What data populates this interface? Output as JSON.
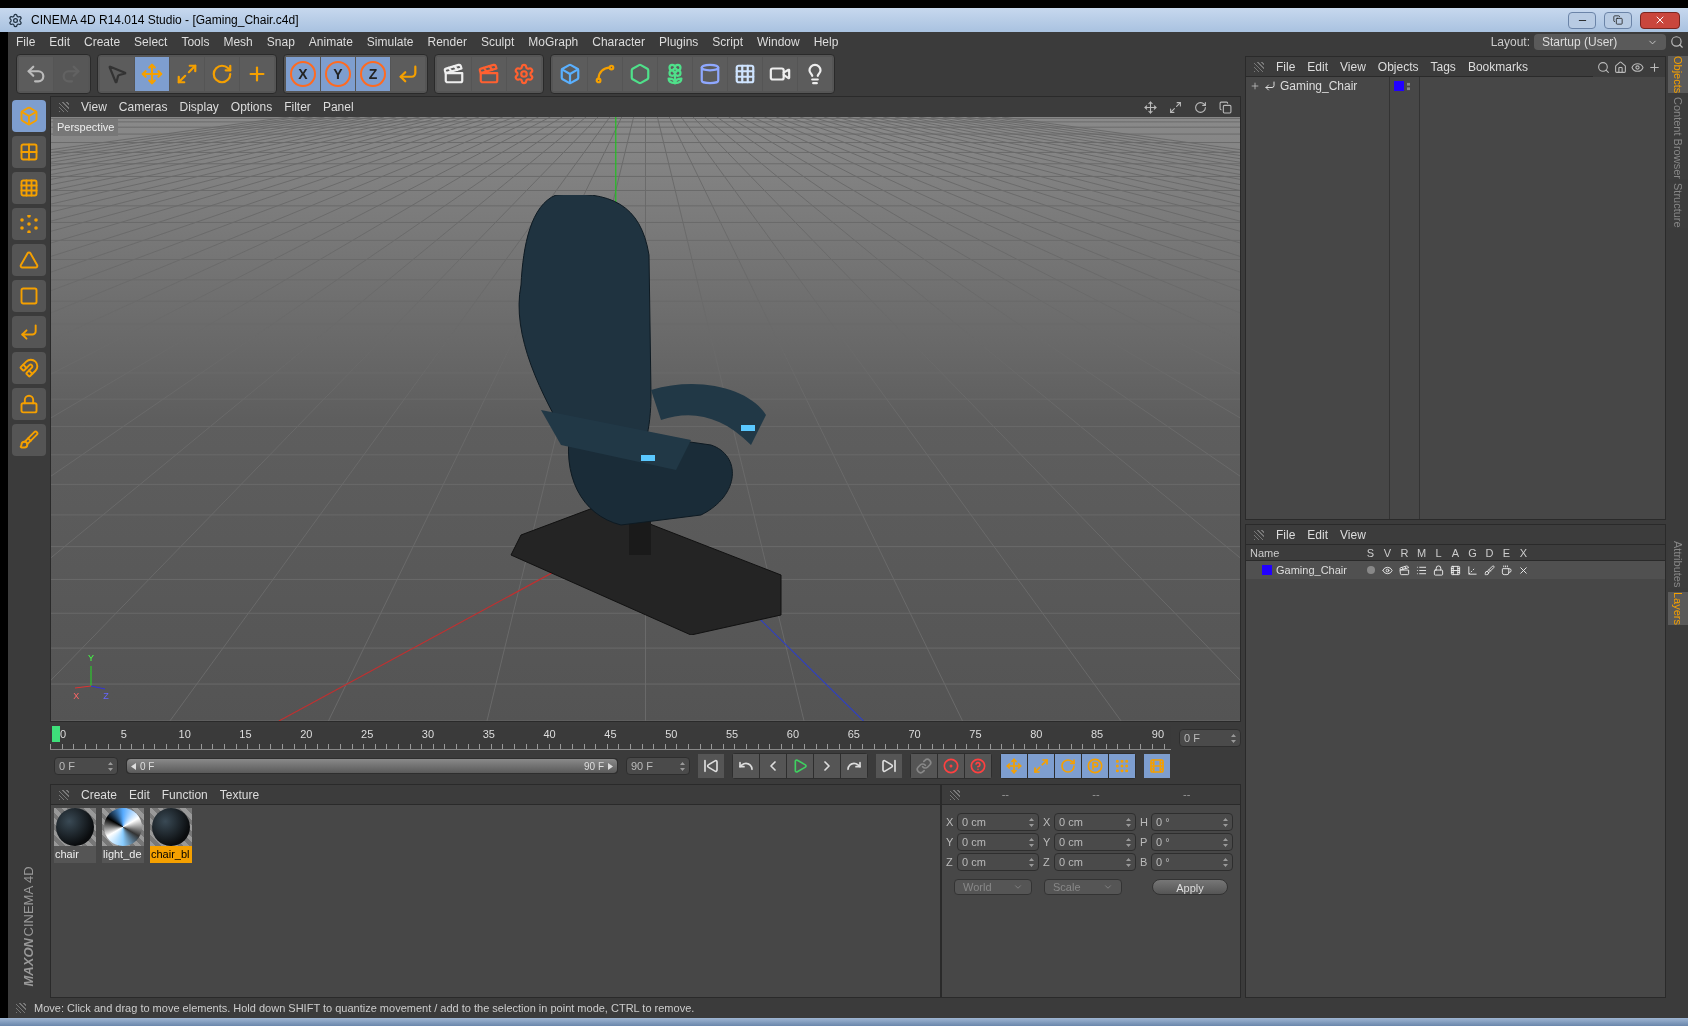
{
  "window": {
    "title": "CINEMA 4D R14.014 Studio - [Gaming_Chair.c4d]"
  },
  "menu_bar": [
    "File",
    "Edit",
    "Create",
    "Select",
    "Tools",
    "Mesh",
    "Snap",
    "Animate",
    "Simulate",
    "Render",
    "Sculpt",
    "MoGraph",
    "Character",
    "Plugins",
    "Script",
    "Window",
    "Help"
  ],
  "layout": {
    "label": "Layout:",
    "value": "Startup (User)"
  },
  "toolbar": [
    {
      "kind": "undo",
      "selected": false,
      "disabled": false
    },
    {
      "kind": "redo",
      "selected": false,
      "disabled": true
    },
    {
      "kind": "select",
      "selected": false,
      "disabled": false
    },
    {
      "kind": "move",
      "selected": true,
      "disabled": false
    },
    {
      "kind": "scale",
      "selected": false,
      "disabled": false
    },
    {
      "kind": "rotate",
      "selected": false,
      "disabled": false
    },
    {
      "kind": "create",
      "selected": false,
      "disabled": false
    },
    {
      "kind": "axis",
      "label": "X",
      "selected": true,
      "disabled": false
    },
    {
      "kind": "axis",
      "label": "Y",
      "selected": true,
      "disabled": false
    },
    {
      "kind": "axis",
      "label": "Z",
      "selected": true,
      "disabled": false
    },
    {
      "kind": "coord",
      "selected": false,
      "disabled": false
    },
    {
      "kind": "render-view",
      "selected": false,
      "disabled": false
    },
    {
      "kind": "render",
      "selected": false,
      "disabled": false
    },
    {
      "kind": "render-settings",
      "selected": false,
      "disabled": false
    },
    {
      "kind": "cube",
      "selected": false,
      "disabled": false
    },
    {
      "kind": "spline",
      "selected": false,
      "disabled": false
    },
    {
      "kind": "generator",
      "selected": false,
      "disabled": false
    },
    {
      "kind": "array",
      "selected": false,
      "disabled": false
    },
    {
      "kind": "deformer",
      "selected": false,
      "disabled": false
    },
    {
      "kind": "floor",
      "selected": false,
      "disabled": false
    },
    {
      "kind": "camera",
      "selected": false,
      "disabled": false
    },
    {
      "kind": "light",
      "selected": false,
      "disabled": false
    }
  ],
  "left_toolbar": [
    {
      "kind": "model",
      "selected": true
    },
    {
      "kind": "texture",
      "selected": false
    },
    {
      "kind": "workplane",
      "selected": false
    },
    {
      "kind": "points",
      "selected": false
    },
    {
      "kind": "edges",
      "selected": false
    },
    {
      "kind": "polygons",
      "selected": false
    },
    {
      "kind": "axis",
      "selected": false
    },
    {
      "kind": "magnet",
      "selected": false
    },
    {
      "kind": "grid-lock",
      "selected": false
    },
    {
      "kind": "paint",
      "selected": false
    }
  ],
  "viewport": {
    "menu": [
      "View",
      "Cameras",
      "Display",
      "Options",
      "Filter",
      "Panel"
    ],
    "label": "Perspective",
    "axis_labels": [
      "Y",
      "X",
      "Z"
    ]
  },
  "timeline": {
    "ticks": [
      "0",
      "5",
      "10",
      "15",
      "20",
      "25",
      "30",
      "35",
      "40",
      "45",
      "50",
      "55",
      "60",
      "65",
      "70",
      "75",
      "80",
      "85",
      "90"
    ],
    "level": 0,
    "frame": "0 F"
  },
  "transport": {
    "start": "0 F",
    "range": {
      "start": "0 F",
      "end": "90 F",
      "level": 1
    },
    "end": "90 F",
    "buttons": [
      {
        "kind": "first"
      },
      {
        "kind": "prev-key"
      },
      {
        "kind": "prev-frame"
      },
      {
        "kind": "play"
      },
      {
        "kind": "next-frame"
      },
      {
        "kind": "next-key"
      },
      {
        "kind": "last"
      },
      {
        "kind": "auto-key"
      },
      {
        "kind": "record"
      },
      {
        "kind": "help"
      },
      {
        "kind": "key-move"
      },
      {
        "kind": "key-scale"
      },
      {
        "kind": "key-rotate"
      },
      {
        "kind": "key-param"
      },
      {
        "kind": "key-points"
      },
      {
        "kind": "timeline"
      }
    ]
  },
  "materials": {
    "menu": [
      "Create",
      "Edit",
      "Function",
      "Texture"
    ],
    "items": [
      {
        "name": "chair",
        "kind": "dark",
        "selected": false
      },
      {
        "name": "light_de",
        "kind": "light",
        "selected": false
      },
      {
        "name": "chair_bl",
        "kind": "dark",
        "selected": true
      }
    ]
  },
  "coordinates": {
    "headers": [
      "--",
      "--",
      "--"
    ],
    "rows": [
      [
        {
          "label": "X",
          "value": "0 cm"
        },
        {
          "label": "X",
          "value": "0 cm"
        },
        {
          "label": "H",
          "value": "0 °"
        }
      ],
      [
        {
          "label": "Y",
          "value": "0 cm"
        },
        {
          "label": "Y",
          "value": "0 cm"
        },
        {
          "label": "P",
          "value": "0 °"
        }
      ],
      [
        {
          "label": "Z",
          "value": "0 cm"
        },
        {
          "label": "Z",
          "value": "0 cm"
        },
        {
          "label": "B",
          "value": "0 °"
        }
      ]
    ],
    "dropdowns": [
      "World",
      "Scale"
    ],
    "apply": "Apply"
  },
  "logo": {
    "brand": "MAXON",
    "product": "CINEMA 4D"
  },
  "objects_panel": {
    "menu": [
      "File",
      "Edit",
      "View",
      "Objects",
      "Tags",
      "Bookmarks"
    ],
    "items": [
      {
        "name": "Gaming_Chair",
        "color": "#2200ff"
      }
    ]
  },
  "layers_panel": {
    "menu": [
      "File",
      "Edit",
      "View"
    ],
    "columns": [
      "Name",
      "S",
      "V",
      "R",
      "M",
      "L",
      "A",
      "G",
      "D",
      "E",
      "X"
    ],
    "rows": [
      {
        "name": "Gaming_Chair",
        "color": "#2200ff"
      }
    ]
  },
  "side_tabs_top": [
    {
      "label": "Objects",
      "selected": true
    },
    {
      "label": "Content Browser",
      "selected": false
    },
    {
      "label": "Structure",
      "selected": false
    }
  ],
  "side_tabs_bottom": [
    {
      "label": "Attributes",
      "selected": false
    },
    {
      "label": "Layers",
      "selected": true
    }
  ],
  "status_bar": "Move: Click and drag to move elements. Hold down SHIFT to quantize movement / add to the selection in point mode, CTRL to remove."
}
